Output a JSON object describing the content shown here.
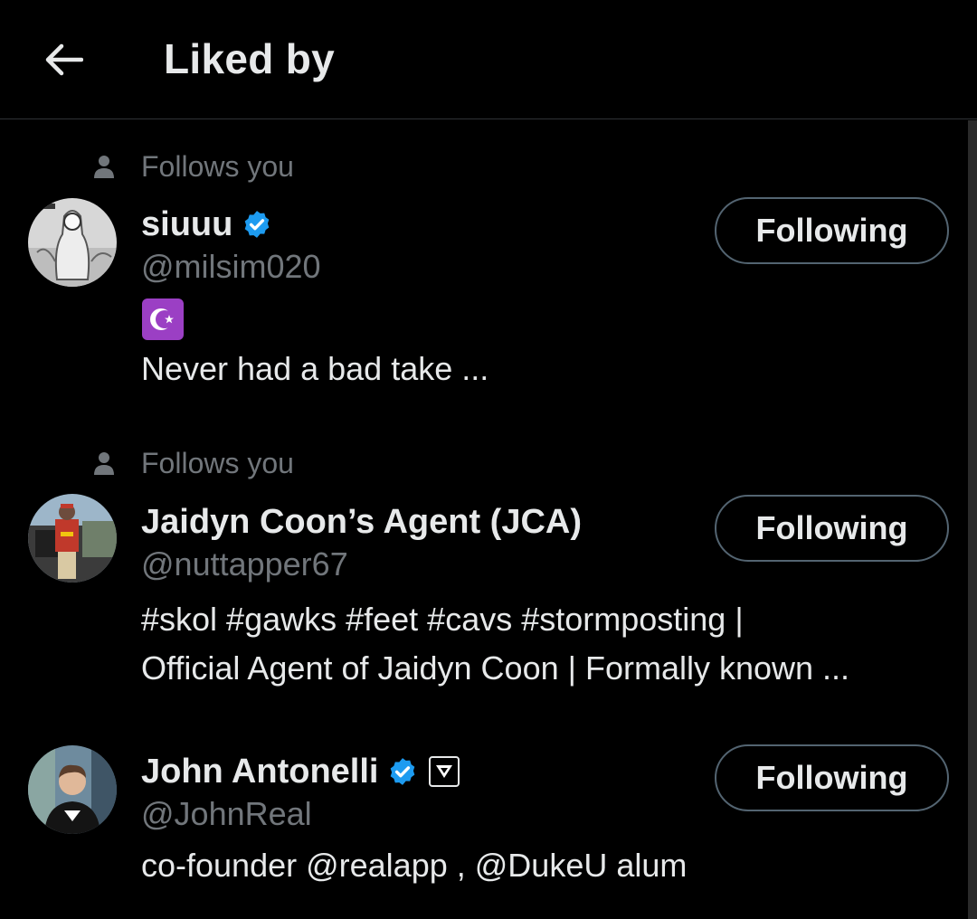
{
  "header": {
    "title": "Liked by",
    "back_icon": "arrow-left-icon"
  },
  "users": [
    {
      "follows_you": "Follows you",
      "name": "siuuu",
      "verified": true,
      "handle": "@milsim020",
      "bio_lines": [
        "Never had a bad take ..."
      ],
      "emoji": "star-and-crescent",
      "button": "Following"
    },
    {
      "follows_you": "Follows you",
      "name": "Jaidyn Coon’s Agent (JCA)",
      "verified": false,
      "handle": "@nuttapper67",
      "bio_lines": [
        "#skol #gawks #feet #cavs #stormposting |",
        "Official Agent of Jaidyn Coon | Formally known ..."
      ],
      "button": "Following"
    },
    {
      "name": "John Antonelli",
      "verified": true,
      "affiliate_badge": true,
      "handle": "@JohnReal",
      "bio_lines": [
        "co-founder @realapp , @DukeU alum"
      ],
      "button": "Following"
    }
  ],
  "colors": {
    "background": "#000000",
    "text": "#e7e9ea",
    "muted": "#71767b",
    "verified": "#1d9bf0",
    "button_border": "#536471"
  }
}
